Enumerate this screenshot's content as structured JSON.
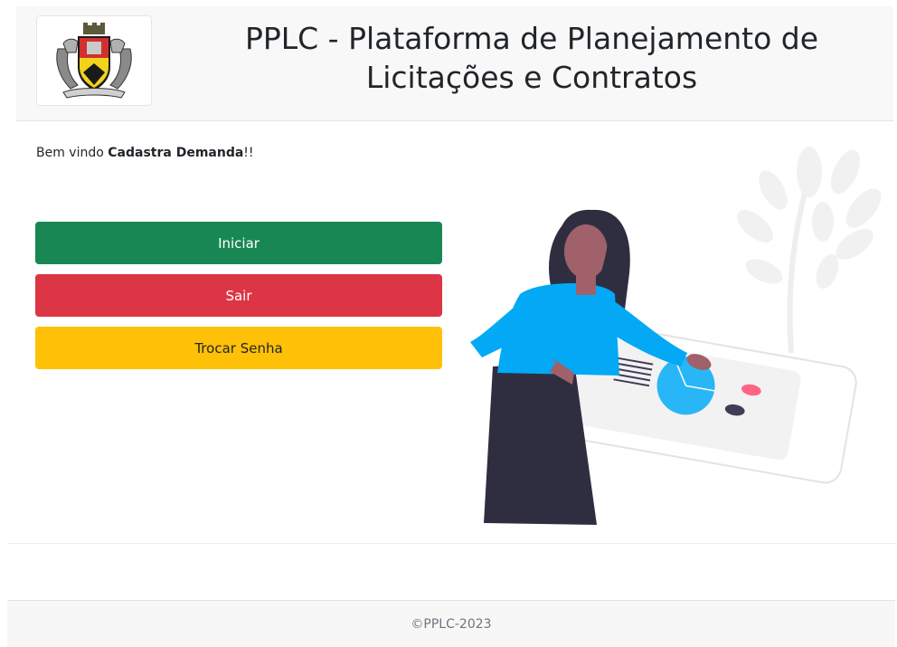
{
  "header": {
    "title_line1": "PPLC - Plataforma de Planejamento de",
    "title_line2": "Licitações e Contratos"
  },
  "welcome": {
    "prefix": "Bem vindo ",
    "user": "Cadastra Demanda",
    "suffix": "!!"
  },
  "buttons": {
    "start": "Iniciar",
    "exit": "Sair",
    "change_password": "Trocar Senha"
  },
  "footer": {
    "text": "©PPLC-2023"
  },
  "colors": {
    "start": "#198754",
    "exit": "#dc3545",
    "change_password": "#ffc107"
  }
}
